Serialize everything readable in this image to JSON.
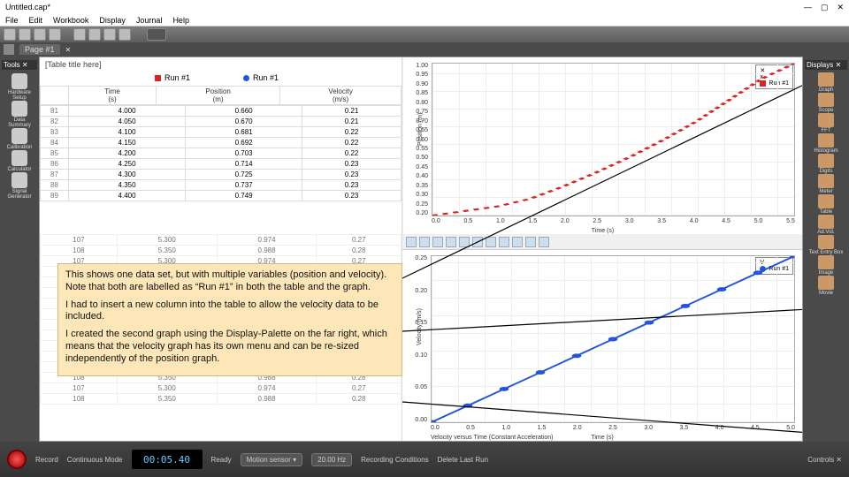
{
  "window": {
    "title": "Untitled.cap*",
    "min": "—",
    "max": "▢",
    "close": "✕"
  },
  "menu": [
    "File",
    "Edit",
    "Workbook",
    "Display",
    "Journal",
    "Help"
  ],
  "page_tab": "Page #1",
  "tools_hdr": "Tools   ✕",
  "left_tools": [
    {
      "label": "Hardware Setup"
    },
    {
      "label": "Data Summary"
    },
    {
      "label": "Calibration"
    },
    {
      "label": "Calculator"
    },
    {
      "label": "Signal Generator"
    }
  ],
  "displays_hdr": "Displays  ✕",
  "right_tools": [
    {
      "label": "Graph"
    },
    {
      "label": "Scope"
    },
    {
      "label": "FFT"
    },
    {
      "label": "Histogram"
    },
    {
      "label": "Digits"
    },
    {
      "label": "Meter"
    },
    {
      "label": "Table"
    },
    {
      "label": "Ad.Vid."
    },
    {
      "label": "Text Entry Box"
    },
    {
      "label": "Image"
    },
    {
      "label": "Movie"
    }
  ],
  "table": {
    "title_placeholder": "[Table title here]",
    "legend_run1": "Run #1",
    "legend_run1b": "Run #1",
    "headers": [
      {
        "name": "Time",
        "unit": "(s)"
      },
      {
        "name": "Position",
        "unit": "(m)"
      },
      {
        "name": "Velocity",
        "unit": "(m/s)"
      }
    ],
    "rows": [
      [
        "81",
        "4.000",
        "0.660",
        "0.21"
      ],
      [
        "82",
        "4.050",
        "0.670",
        "0.21"
      ],
      [
        "83",
        "4.100",
        "0.681",
        "0.22"
      ],
      [
        "84",
        "4.150",
        "0.692",
        "0.22"
      ],
      [
        "85",
        "4.200",
        "0.703",
        "0.22"
      ],
      [
        "86",
        "4.250",
        "0.714",
        "0.23"
      ],
      [
        "87",
        "4.300",
        "0.725",
        "0.23"
      ],
      [
        "88",
        "4.350",
        "0.737",
        "0.23"
      ],
      [
        "89",
        "4.400",
        "0.749",
        "0.23"
      ]
    ],
    "rows2": [
      [
        "107",
        "5.300",
        "0.974",
        "0.27"
      ],
      [
        "108",
        "5.350",
        "0.988",
        "0.28"
      ]
    ]
  },
  "graph1": {
    "ylabel": "Position (m)",
    "xlabel": "Time (s)",
    "yticks": [
      "0.20",
      "0.25",
      "0.30",
      "0.35",
      "0.40",
      "0.45",
      "0.50",
      "0.55",
      "0.60",
      "0.65",
      "0.70",
      "0.75",
      "0.80",
      "0.85",
      "0.90",
      "0.95",
      "1.00"
    ],
    "xticks": [
      "0.0",
      "0.5",
      "1.0",
      "1.5",
      "2.0",
      "2.5",
      "3.0",
      "3.5",
      "4.0",
      "4.5",
      "5.0",
      "5.5"
    ],
    "legend_x": "x",
    "legend_run": "Run #1"
  },
  "graph2": {
    "ylabel": "Velocity (m/s)",
    "xlabel": "Time (s)",
    "title": "Velocity versus Time (Constant Acceleration)",
    "yticks": [
      "0.00",
      "0.05",
      "0.10",
      "0.15",
      "0.20",
      "0.25"
    ],
    "xticks": [
      "0.0",
      "0.5",
      "1.0",
      "1.5",
      "2.0",
      "2.5",
      "3.0",
      "3.5",
      "4.0",
      "4.5",
      "5.0"
    ],
    "legend_v": "V",
    "legend_run": "Run #1"
  },
  "callout": {
    "p1": "This shows one data set, but with multiple variables (position and velocity).  Note that both are labelled as “Run #1” in both the table and the graph.",
    "p2": "I had to insert a new column into the table to allow the velocity data to be included.",
    "p3": "I created the second graph using the Display-Palette on the far right, which means that the velocity graph has its own menu and can be re-sized independently of the position graph."
  },
  "status": {
    "record": "Record",
    "continuous": "Continuous Mode",
    "timer": "00:05.40",
    "ready": "Ready",
    "sensor": "Motion sensor ▾",
    "rate": "20.00 Hz",
    "rec_cond": "Recording Conditions",
    "del_last": "Delete Last Run",
    "controls": "Controls  ✕"
  },
  "chart_data": [
    {
      "type": "line",
      "name": "Position vs Time",
      "xlabel": "Time (s)",
      "ylabel": "Position (m)",
      "xlim": [
        0,
        5.5
      ],
      "ylim": [
        0.2,
        1.0
      ],
      "series": [
        {
          "name": "Run #1",
          "color": "#d22",
          "x": [
            0.0,
            0.5,
            1.0,
            1.5,
            2.0,
            2.5,
            3.0,
            3.5,
            4.0,
            4.5,
            5.0,
            5.5
          ],
          "y": [
            0.2,
            0.22,
            0.25,
            0.29,
            0.35,
            0.42,
            0.51,
            0.6,
            0.7,
            0.81,
            0.92,
            1.0
          ]
        }
      ]
    },
    {
      "type": "scatter",
      "name": "Velocity vs Time",
      "title": "Velocity versus Time (Constant Acceleration)",
      "xlabel": "Time (s)",
      "ylabel": "Velocity (m/s)",
      "xlim": [
        0,
        5.0
      ],
      "ylim": [
        0.0,
        0.25
      ],
      "series": [
        {
          "name": "Run #1",
          "color": "#25d",
          "x": [
            0.0,
            0.5,
            1.0,
            1.5,
            2.0,
            2.5,
            3.0,
            3.5,
            4.0,
            4.5,
            5.0
          ],
          "y": [
            0.0,
            0.025,
            0.05,
            0.075,
            0.1,
            0.125,
            0.15,
            0.175,
            0.2,
            0.225,
            0.25
          ]
        }
      ]
    }
  ]
}
